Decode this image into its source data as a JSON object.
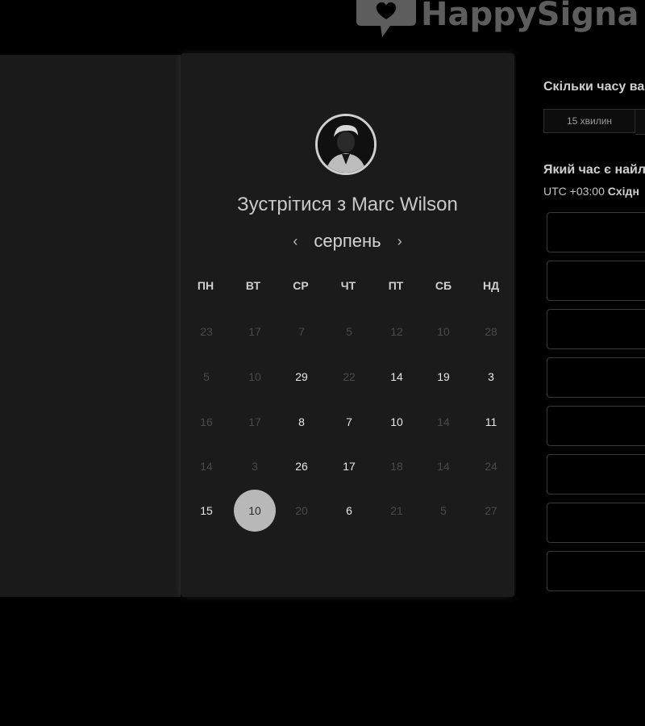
{
  "brand": {
    "name": "HappySigna",
    "color": "#5d5d5d"
  },
  "card": {
    "title_prefix": "Зустрітися з",
    "host_name": "Marc Wilson",
    "month": "серпень",
    "weekdays": [
      "ПН",
      "ВТ",
      "СР",
      "ЧТ",
      "ПТ",
      "СБ",
      "НД"
    ],
    "weeks": [
      [
        {
          "d": "23",
          "s": "off"
        },
        {
          "d": "17",
          "s": "off"
        },
        {
          "d": "7",
          "s": "off"
        },
        {
          "d": "5",
          "s": "off"
        },
        {
          "d": "12",
          "s": "off"
        },
        {
          "d": "10",
          "s": "off"
        },
        {
          "d": "28",
          "s": "off"
        }
      ],
      [
        {
          "d": "5",
          "s": "off"
        },
        {
          "d": "10",
          "s": "off"
        },
        {
          "d": "29",
          "s": "on"
        },
        {
          "d": "22",
          "s": "off"
        },
        {
          "d": "14",
          "s": "on"
        },
        {
          "d": "19",
          "s": "on"
        },
        {
          "d": "3",
          "s": "on"
        }
      ],
      [
        {
          "d": "16",
          "s": "off"
        },
        {
          "d": "17",
          "s": "off"
        },
        {
          "d": "8",
          "s": "on"
        },
        {
          "d": "7",
          "s": "on"
        },
        {
          "d": "10",
          "s": "on"
        },
        {
          "d": "14",
          "s": "off"
        },
        {
          "d": "11",
          "s": "on"
        }
      ],
      [
        {
          "d": "14",
          "s": "off"
        },
        {
          "d": "3",
          "s": "off"
        },
        {
          "d": "26",
          "s": "on"
        },
        {
          "d": "17",
          "s": "on"
        },
        {
          "d": "18",
          "s": "off"
        },
        {
          "d": "14",
          "s": "off"
        },
        {
          "d": "24",
          "s": "off"
        }
      ],
      [
        {
          "d": "15",
          "s": "on"
        },
        {
          "d": "10",
          "s": "sel"
        },
        {
          "d": "20",
          "s": "off"
        },
        {
          "d": "6",
          "s": "on"
        },
        {
          "d": "21",
          "s": "off"
        },
        {
          "d": "5",
          "s": "off"
        },
        {
          "d": "27",
          "s": "off"
        }
      ]
    ]
  },
  "right": {
    "duration_question": "Скільки часу ва",
    "duration_option": "15 хвилин",
    "time_question": "Який час є найл",
    "timezone_prefix": "UTC +03:00",
    "timezone_name": "Східн",
    "slot_count": 8
  }
}
